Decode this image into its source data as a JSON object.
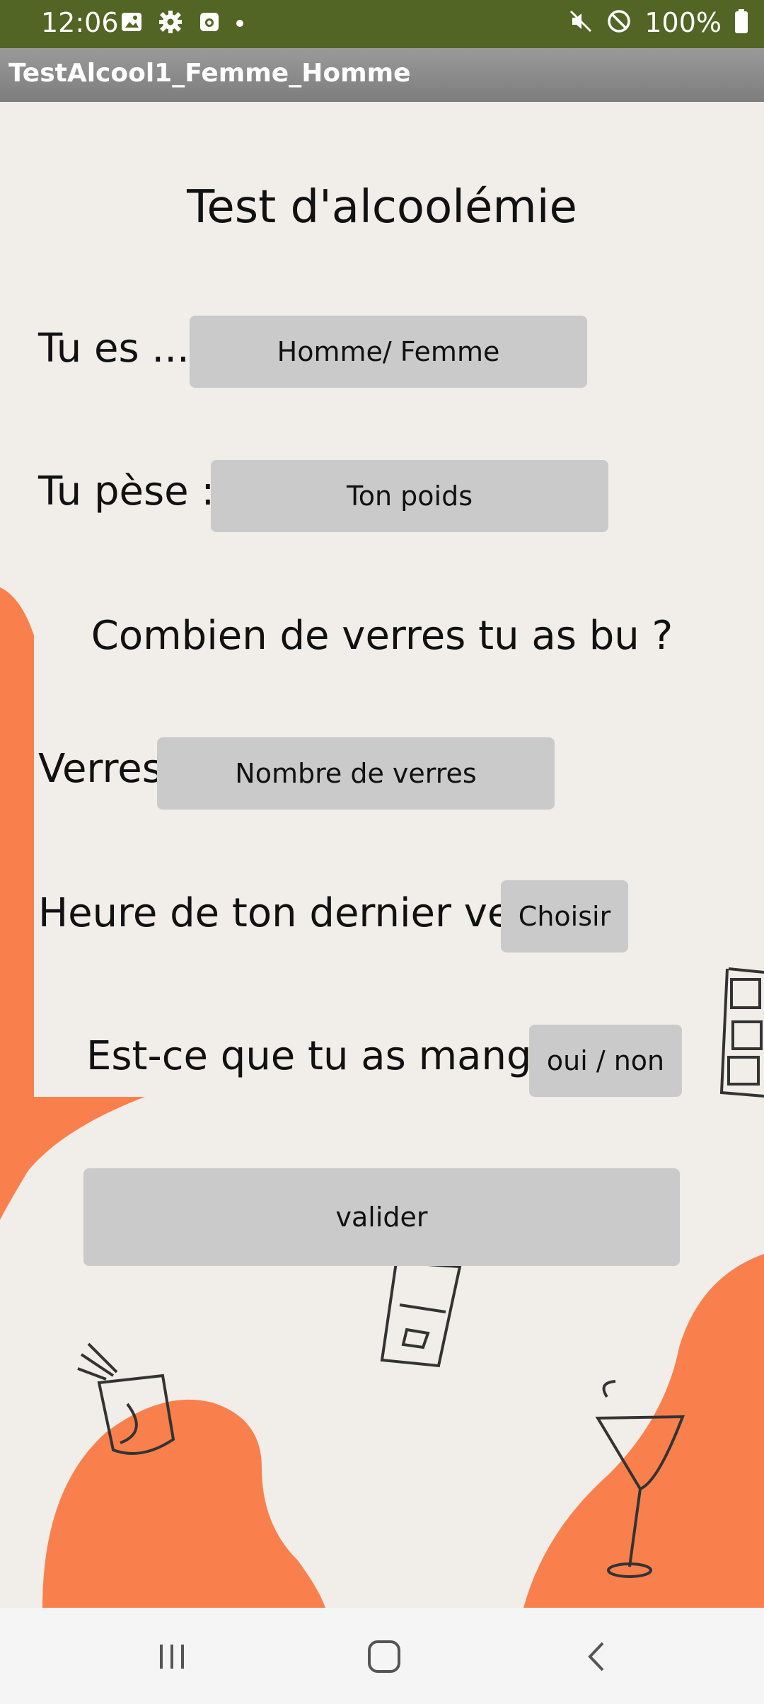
{
  "status_bar": {
    "time": "12:06",
    "battery_percent": "100%",
    "left_icons": [
      "image-icon",
      "settings-icon",
      "screen-record-icon",
      "notification-dot"
    ],
    "right_icons": [
      "mute-icon",
      "dnd-icon",
      "battery-icon"
    ],
    "background_color": "#526524"
  },
  "app": {
    "title": "TestAlcool1_Femme_Homme"
  },
  "form": {
    "heading": "Test d'alcoolémie",
    "sex_label": "Tu es ....",
    "sex_button": "Homme/ Femme",
    "weight_label": "Tu pèse :",
    "weight_button": "Ton poids",
    "glasses_question": "Combien de verres tu as bu ?",
    "glasses_label": "Verres",
    "glasses_button": "Nombre de verres",
    "last_drink_label": "Heure de ton dernier verre",
    "last_drink_button": "Choisir",
    "ate_label": "Est-ce que tu as mangé ?",
    "ate_button": "oui / non",
    "submit_button": "valider"
  },
  "theme": {
    "accent_orange": "#f9804c",
    "button_gray": "#cacaca",
    "background": "#f1ede8"
  },
  "nav_bar": {
    "buttons": [
      "recent-apps-icon",
      "home-icon",
      "back-icon"
    ]
  }
}
